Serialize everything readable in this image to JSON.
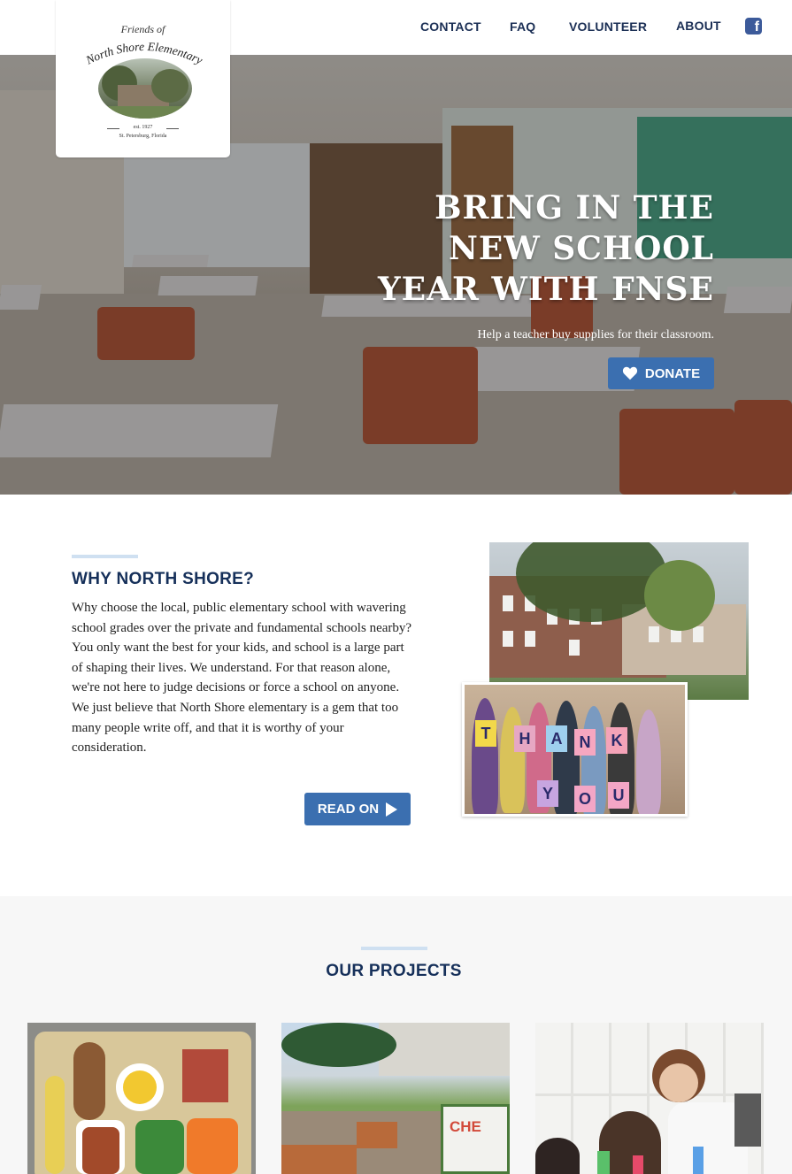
{
  "header": {
    "nav": [
      "CONTACT",
      "FAQ",
      "VOLUNTEER",
      "ABOUT"
    ],
    "facebook_icon": "facebook-icon"
  },
  "logo": {
    "line1": "Friends of",
    "line2": "North Shore Elementary",
    "est": "est. 1927",
    "location": "St. Petersburg, Florida"
  },
  "hero": {
    "title_lines": [
      "BRING IN THE",
      "NEW SCHOOL",
      "YEAR WITH FNSE"
    ],
    "subtitle": "Help a teacher buy supplies for their classroom.",
    "donate_label": "DONATE",
    "donate_icon": "heart-icon"
  },
  "why": {
    "heading": "WHY NORTH SHORE?",
    "body": "Why choose the local, public elementary school with wavering school grades over the private and fundamental schools nearby? You only want the best for your kids, and school is a large part of shaping their lives. We understand. For that reason alone, we're not here to judge decisions or force a school on anyone. We just believe that North Shore elementary is a gem that too many people write off, and that it is worthy of your consideration.",
    "read_on_label": "READ ON",
    "read_on_icon": "play-arrow-icon",
    "thank_you_letters": [
      "T",
      "H",
      "A",
      "N",
      "K",
      "Y",
      "O",
      "U"
    ]
  },
  "projects": {
    "heading": "OUR PROJECTS"
  },
  "colors": {
    "navy": "#16305a",
    "button_blue": "#3b6fb0",
    "rule_blue": "#cfe0f1",
    "section_grey": "#f7f7f7"
  }
}
